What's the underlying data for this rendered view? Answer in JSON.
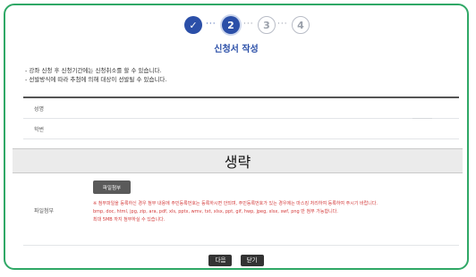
{
  "stepper": {
    "steps": [
      "✓",
      "2",
      "3",
      "4"
    ],
    "dots": "···"
  },
  "title": "신청서 작성",
  "notes": [
    "- 강좌 신청 후 신청기간에는 신청취소를 할 수 있습니다.",
    "- 선발방식에 따라 추첨에 의해 대상이 선발될 수 있습니다."
  ],
  "rows": [
    {
      "label": "성명",
      "value": ""
    },
    {
      "label": "학번",
      "value": ""
    }
  ],
  "omitted": "생략",
  "attachment": {
    "label": "파일첨부",
    "button": "파일첨부",
    "lines": [
      "※ 첨부파일을 등록하신 경우 첨부 내용에 주민등록번호는 등록하시면 안되며, 주민등록번호가 있는 경우에는 마스킹 처리하여 등록하여 주시기 바랍니다.",
      "bmp, doc, html, jpg, zip, ara, pdf, xls, pptx, wmv, txt, xlsx, ppt, gif, hwp, jpeg, xlsx, swf, png 만 첨부 가능합니다.",
      "최대 5MB 까지 첨부하실 수 있습니다."
    ]
  },
  "buttons": {
    "next": "다음",
    "close": "닫기"
  },
  "colors": {
    "frame": "#2fa866",
    "accent": "#2b4fa8",
    "warning": "#d43c3c"
  }
}
